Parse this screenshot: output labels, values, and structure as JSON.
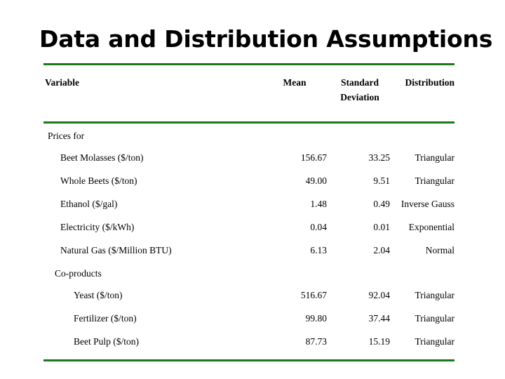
{
  "slide": {
    "title": "Data and Distribution Assumptions",
    "rule_color": "#1a7a1a"
  },
  "table": {
    "headers": {
      "variable": "Variable",
      "mean": "Mean",
      "std_dev_line1": "Standard",
      "std_dev_line2": "Deviation",
      "distribution": "Distribution"
    },
    "groups": [
      {
        "group_label": "Prices for",
        "rows": [
          {
            "label": "Beet Molasses ($/ton)",
            "mean": "156.67",
            "sd": "33.25",
            "dist": "Triangular"
          },
          {
            "label": "Whole Beets    ($/ton)",
            "mean": "49.00",
            "sd": "9.51",
            "dist": "Triangular"
          },
          {
            "label": "Ethanol ($/gal)",
            "mean": "1.48",
            "sd": "0.49",
            "dist": "Inverse Gauss"
          },
          {
            "label": "Electricity ($/kWh)",
            "mean": "0.04",
            "sd": "0.01",
            "dist": "Exponential"
          },
          {
            "label": "Natural Gas ($/Million BTU)",
            "mean": "6.13",
            "sd": "2.04",
            "dist": "Normal"
          }
        ]
      },
      {
        "group_label": "Co-products",
        "rows": [
          {
            "label": "Yeast       ($/ton)",
            "mean": "516.67",
            "sd": "92.04",
            "dist": "Triangular"
          },
          {
            "label": "Fertilizer  ($/ton)",
            "mean": "99.80",
            "sd": "37.44",
            "dist": "Triangular"
          },
          {
            "label": "Beet Pulp ($/ton)",
            "mean": "87.73",
            "sd": "15.19",
            "dist": "Triangular"
          }
        ]
      }
    ]
  }
}
